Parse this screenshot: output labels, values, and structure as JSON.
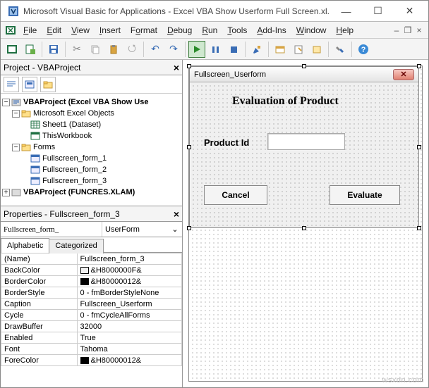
{
  "titlebar": {
    "text": "Microsoft Visual Basic for Applications - Excel VBA Show Userform Full Screen.xl..."
  },
  "menu": {
    "file": "File",
    "edit": "Edit",
    "view": "View",
    "insert": "Insert",
    "format": "Format",
    "debug": "Debug",
    "run": "Run",
    "tools": "Tools",
    "addins": "Add-Ins",
    "window": "Window",
    "help": "Help"
  },
  "project": {
    "title": "Project - VBAProject",
    "root": "VBAProject (Excel VBA Show Use",
    "mexo": "Microsoft Excel Objects",
    "sheet1": "Sheet1 (Dataset)",
    "thiswb": "ThisWorkbook",
    "forms": "Forms",
    "f1": "Fullscreen_form_1",
    "f2": "Fullscreen_form_2",
    "f3": "Fullscreen_form_3",
    "funcres": "VBAProject (FUNCRES.XLAM)"
  },
  "props": {
    "title": "Properties - Fullscreen_form_3",
    "objname": "Fullscreen_form_",
    "objtype": "UserForm",
    "tab_alpha": "Alphabetic",
    "tab_cat": "Categorized",
    "rows": [
      {
        "k": "(Name)",
        "v": "Fullscreen_form_3"
      },
      {
        "k": "BackColor",
        "v": "&H8000000F&",
        "sw": "#f0f0f0"
      },
      {
        "k": "BorderColor",
        "v": "&H80000012&",
        "sw": "#000000"
      },
      {
        "k": "BorderStyle",
        "v": "0 - fmBorderStyleNone"
      },
      {
        "k": "Caption",
        "v": "Fullscreen_Userform"
      },
      {
        "k": "Cycle",
        "v": "0 - fmCycleAllForms"
      },
      {
        "k": "DrawBuffer",
        "v": "32000"
      },
      {
        "k": "Enabled",
        "v": "True"
      },
      {
        "k": "Font",
        "v": "Tahoma"
      },
      {
        "k": "ForeColor",
        "v": "&H80000012&",
        "sw": "#000000"
      }
    ]
  },
  "userform": {
    "caption": "Fullscreen_Userform",
    "heading": "Evaluation of Product",
    "label": "Product Id",
    "cancel": "Cancel",
    "eval": "Evaluate"
  },
  "watermark": "wsxdn.com"
}
